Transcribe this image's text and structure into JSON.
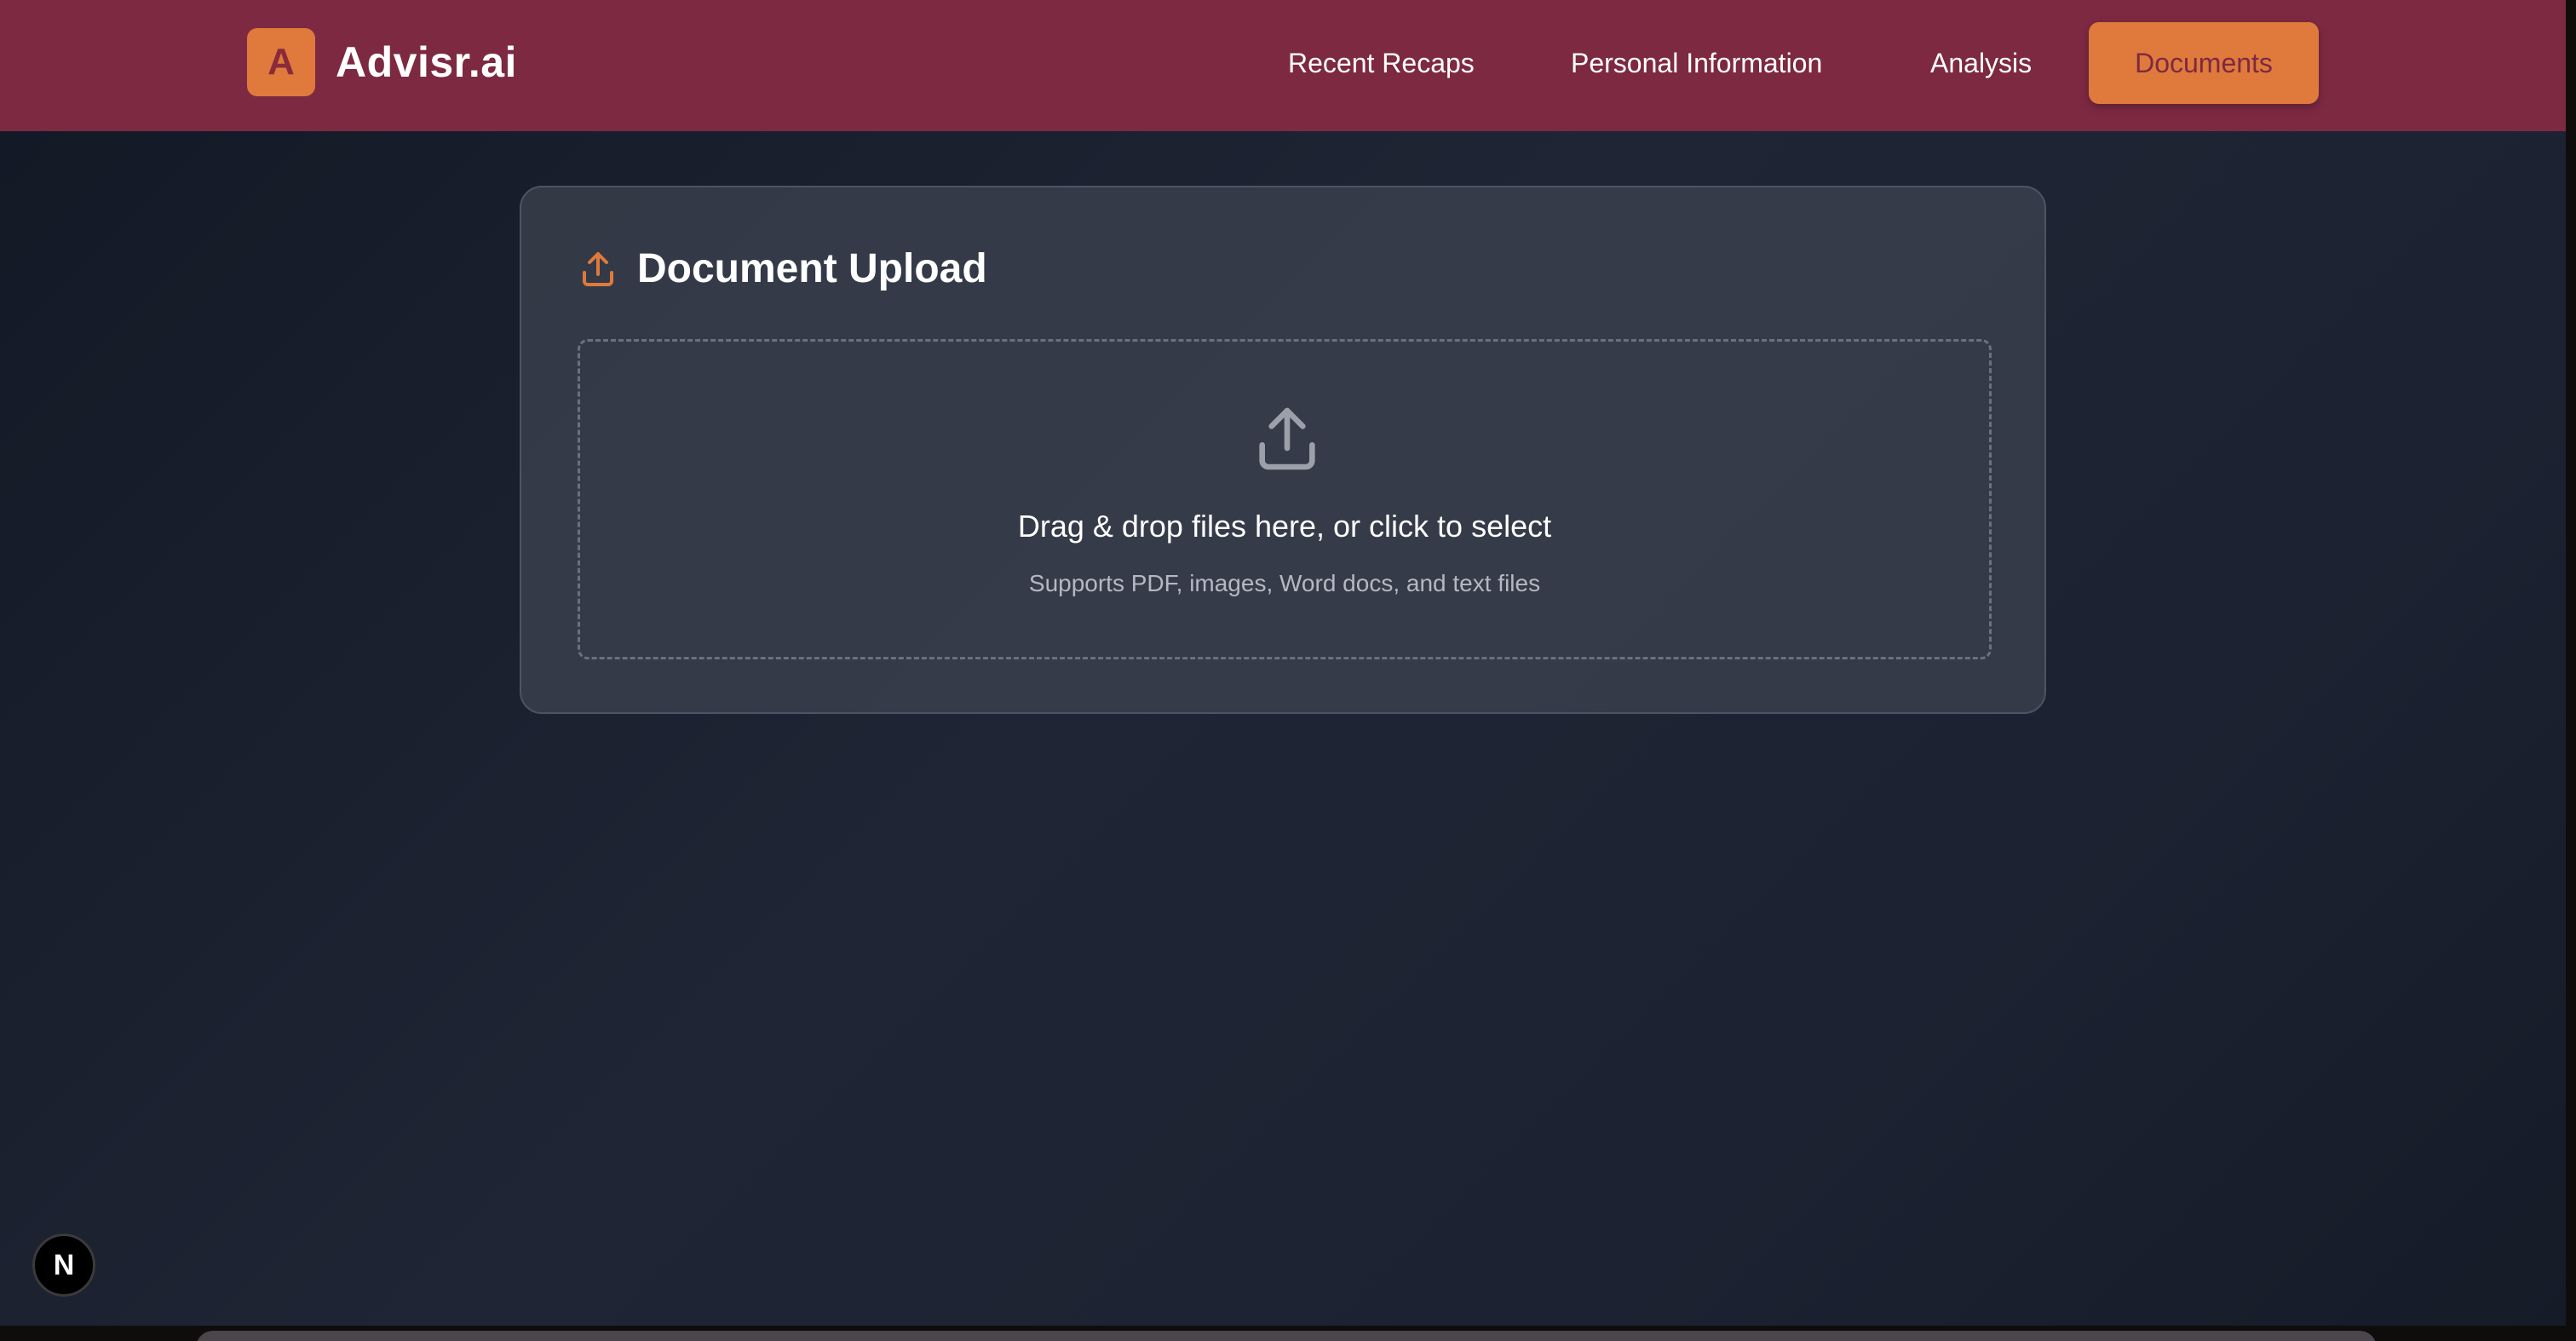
{
  "brand": {
    "logo_letter": "A",
    "name": "Advisr.ai"
  },
  "nav": {
    "items": [
      {
        "label": "Recent Recaps",
        "active": false
      },
      {
        "label": "Personal Information",
        "active": false
      },
      {
        "label": "Analysis",
        "active": false
      },
      {
        "label": "Documents",
        "active": true
      }
    ]
  },
  "upload": {
    "title": "Document Upload",
    "drop_title": "Drag & drop files here, or click to select",
    "drop_subtitle": "Supports PDF, images, Word docs, and text files"
  },
  "dev_badge": {
    "letter": "N"
  },
  "colors": {
    "navbar": "#7d2942",
    "accent": "#df7a3c",
    "background": "#1f2534",
    "card": "#3e4350"
  },
  "icons": {
    "header_upload": "upload-icon",
    "dropzone_upload": "upload-icon"
  }
}
